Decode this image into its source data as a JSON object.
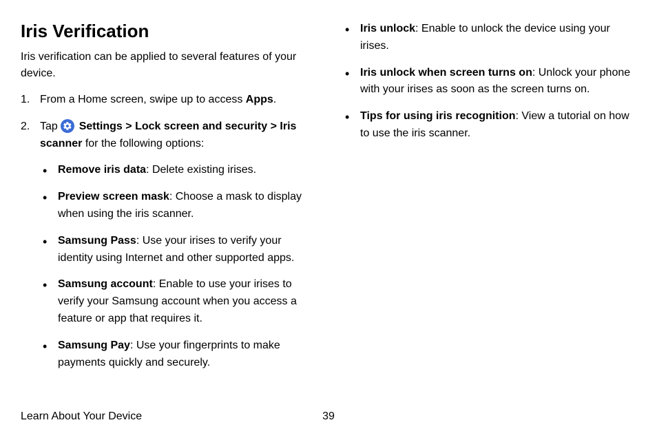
{
  "heading": "Iris Verification",
  "intro": "Iris verification can be applied to several features of your device.",
  "step1": {
    "num": "1.",
    "prefix": "From a Home screen, swipe up to access ",
    "bold": "Apps",
    "suffix": "."
  },
  "step2": {
    "num": "2.",
    "tap": "Tap ",
    "settings": "Settings",
    "chev1": " > ",
    "lock": "Lock screen and security",
    "chev2": " > ",
    "iris": "Iris scanner",
    "tail": " for the following options:"
  },
  "opts_left": [
    {
      "bold": "Remove iris data",
      "text": ": Delete existing irises."
    },
    {
      "bold": "Preview screen mask",
      "text": ": Choose a mask to display when using the iris scanner."
    },
    {
      "bold": "Samsung Pass",
      "text": ": Use your irises to verify your identity using Internet and other supported apps."
    },
    {
      "bold": "Samsung account",
      "text": ": Enable to use your irises to verify your Samsung account when you access a feature or app that requires it."
    },
    {
      "bold": "Samsung Pay",
      "text": ": Use your fingerprints to make payments quickly and securely."
    }
  ],
  "opts_right": [
    {
      "bold": "Iris unlock",
      "text": ": Enable to unlock the device using your irises."
    },
    {
      "bold": "Iris unlock when screen turns on",
      "text": ": Unlock your phone with your irises as soon as the screen turns on."
    },
    {
      "bold": "Tips for using iris recognition",
      "text": ": View a tutorial on how to use the iris scanner."
    }
  ],
  "footer": {
    "section": "Learn About Your Device",
    "page": "39"
  }
}
